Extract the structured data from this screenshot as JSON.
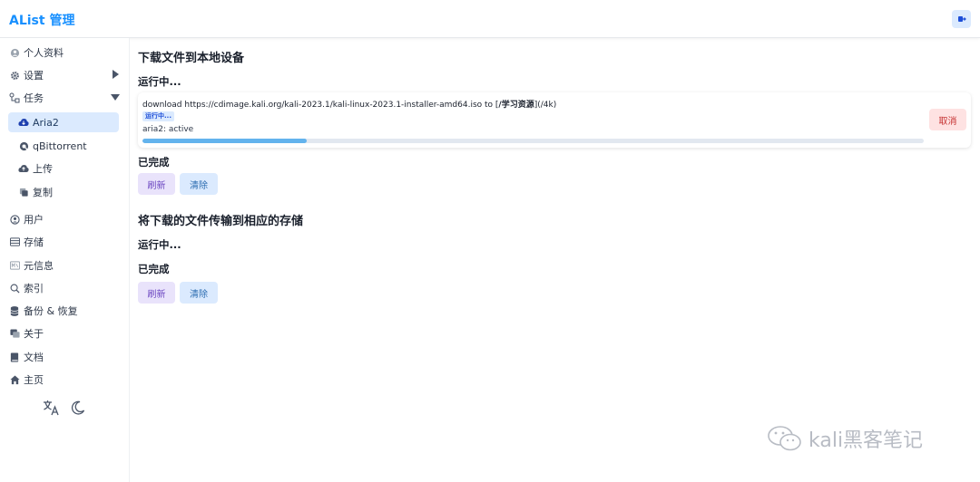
{
  "header": {
    "title": "AList 管理"
  },
  "sidebar": {
    "items": [
      {
        "label": "个人资料"
      },
      {
        "label": "设置"
      },
      {
        "label": "任务"
      },
      {
        "label": "Aria2"
      },
      {
        "label": "qBittorrent"
      },
      {
        "label": "上传"
      },
      {
        "label": "复制"
      },
      {
        "label": "用户"
      },
      {
        "label": "存储"
      },
      {
        "label": "元信息"
      },
      {
        "label": "索引"
      },
      {
        "label": "备份 & 恢复"
      },
      {
        "label": "关于"
      },
      {
        "label": "文档"
      },
      {
        "label": "主页"
      }
    ]
  },
  "main": {
    "section1_title": "下载文件到本地设备",
    "running_label": "运行中...",
    "task": {
      "name_prefix": "download https://cdimage.kali.org/kali-2023.1/kali-linux-2023.1-installer-amd64.iso to [",
      "name_bold": "/学习资源",
      "name_suffix": "](/4k)",
      "badge": "运行中...",
      "status": "aria2: active",
      "progress_percent": 21,
      "cancel_label": "取消"
    },
    "completed_label": "已完成",
    "refresh_label": "刷新",
    "clear_label": "清除",
    "section2_title": "将下载的文件传输到相应的存储",
    "running_label_2": "运行中...",
    "completed_label_2": "已完成",
    "refresh_label_2": "刷新",
    "clear_label_2": "清除"
  },
  "watermark": {
    "text": "kali黑客笔记"
  }
}
